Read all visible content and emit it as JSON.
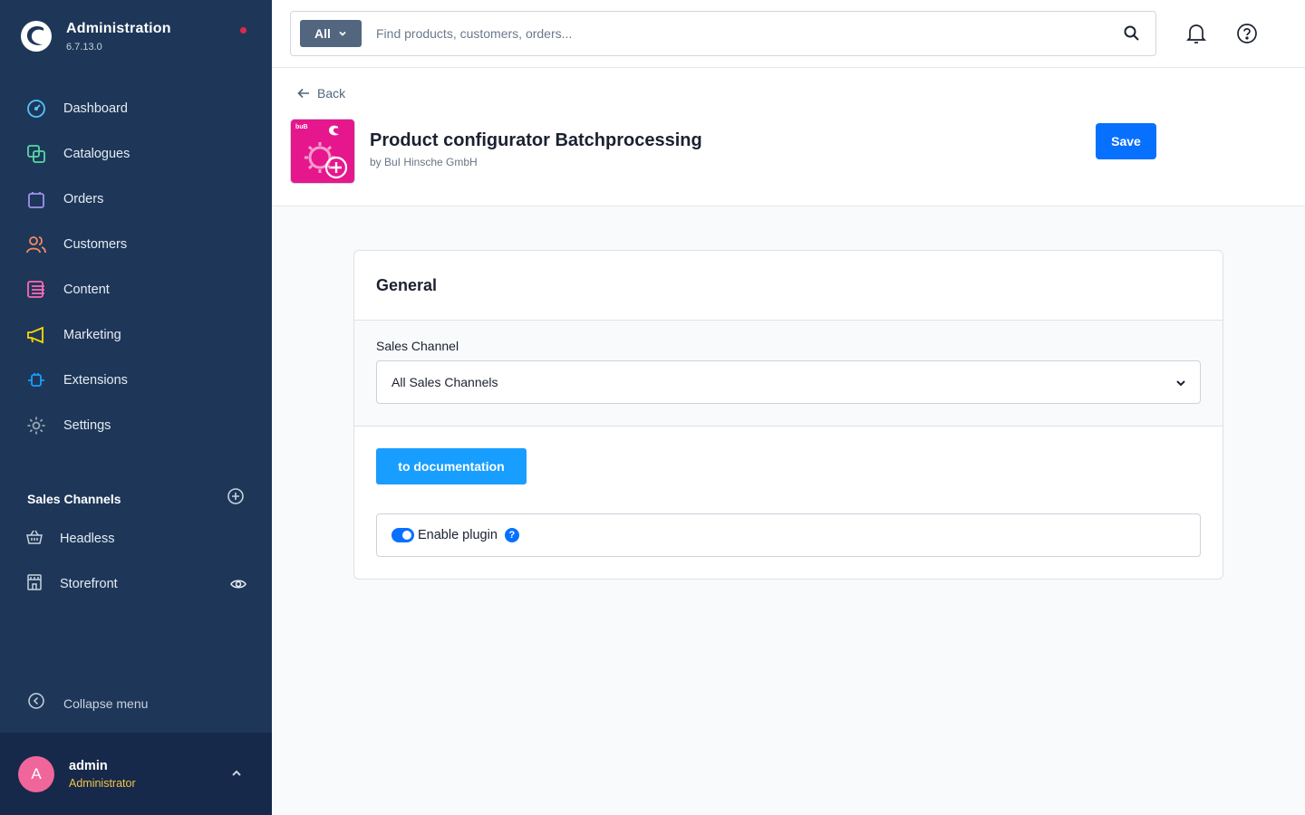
{
  "app": {
    "title": "Administration",
    "version": "6.7.13.0"
  },
  "sidebar": {
    "items": [
      {
        "label": "Dashboard",
        "icon": "gauge-icon",
        "color": "#56c3f9"
      },
      {
        "label": "Catalogues",
        "icon": "catalogue-icon",
        "color": "#57d9a3"
      },
      {
        "label": "Orders",
        "icon": "shopping-bag-icon",
        "color": "#a092f0"
      },
      {
        "label": "Customers",
        "icon": "users-icon",
        "color": "#f88962"
      },
      {
        "label": "Content",
        "icon": "content-icon",
        "color": "#ff68b4"
      },
      {
        "label": "Marketing",
        "icon": "megaphone-icon",
        "color": "#ffd700"
      },
      {
        "label": "Extensions",
        "icon": "plug-icon",
        "color": "#189eff"
      },
      {
        "label": "Settings",
        "icon": "gear-icon",
        "color": "#9aa8b5"
      }
    ],
    "sales_channels_title": "Sales Channels",
    "sales_channels": [
      {
        "label": "Headless",
        "icon": "basket-icon"
      },
      {
        "label": "Storefront",
        "icon": "storefront-icon"
      }
    ],
    "collapse_label": "Collapse menu"
  },
  "user": {
    "initial": "A",
    "name": "admin",
    "role": "Administrator"
  },
  "search": {
    "type_label": "All",
    "placeholder": "Find products, customers, orders..."
  },
  "page": {
    "back_label": "Back",
    "plugin_title": "Product configurator Batchprocessing",
    "plugin_vendor": "by BuI Hinsche GmbH",
    "logo_tag": "buB",
    "save_label": "Save"
  },
  "card": {
    "title": "General",
    "sales_channel_label": "Sales Channel",
    "sales_channel_value": "All Sales Channels",
    "doc_button_label": "to documentation",
    "enable_plugin_label": "Enable plugin",
    "enable_plugin_checked": true,
    "help_glyph": "?"
  },
  "colors": {
    "sidebar_bg": "#1e3759",
    "primary": "#0870ff",
    "doc_button": "#189eff",
    "plugin_logo": "#e6178d",
    "avatar": "#f0669b",
    "role_text": "#f6c343",
    "notification_dot": "#de294c"
  }
}
